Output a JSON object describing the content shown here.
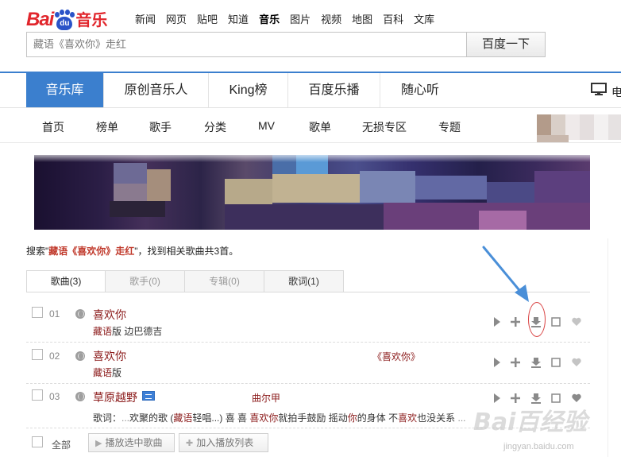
{
  "logo": {
    "bai": "Bai",
    "du": "du",
    "yinle": "音乐"
  },
  "top_nav": [
    {
      "label": "新闻",
      "active": false
    },
    {
      "label": "网页",
      "active": false
    },
    {
      "label": "贴吧",
      "active": false
    },
    {
      "label": "知道",
      "active": false
    },
    {
      "label": "音乐",
      "active": true
    },
    {
      "label": "图片",
      "active": false
    },
    {
      "label": "视频",
      "active": false
    },
    {
      "label": "地图",
      "active": false
    },
    {
      "label": "百科",
      "active": false
    },
    {
      "label": "文库",
      "active": false
    }
  ],
  "search": {
    "value": "藏语《喜欢你》走红",
    "button_label": "百度一下"
  },
  "main_nav": {
    "items": [
      {
        "label": "音乐库",
        "active": true
      },
      {
        "label": "原创音乐人",
        "active": false
      },
      {
        "label": "King榜",
        "active": false
      },
      {
        "label": "百度乐播",
        "active": false
      },
      {
        "label": "随心听",
        "active": false
      }
    ],
    "pc_label": "电"
  },
  "sub_nav": [
    "首页",
    "榜单",
    "歌手",
    "分类",
    "MV",
    "歌单",
    "无损专区",
    "专题"
  ],
  "result_summary": {
    "prefix": "搜索\"",
    "keyword": "藏语《喜欢你》走红",
    "suffix": "\"，找到相关歌曲共3首。"
  },
  "tabs": [
    {
      "label": "歌曲(3)",
      "active": true
    },
    {
      "label": "歌手(0)",
      "active": false
    },
    {
      "label": "专辑(0)",
      "active": false
    },
    {
      "label": "歌词(1)",
      "active": false
    }
  ],
  "songs": [
    {
      "num": "01",
      "title": "喜欢你",
      "sub_hl": "藏语",
      "sub_rest": "版 边巴德吉",
      "album": "",
      "singer": ""
    },
    {
      "num": "02",
      "title": "喜欢你",
      "sub_hl": "藏语",
      "sub_rest": "版",
      "album": "《喜欢你》",
      "singer": ""
    },
    {
      "num": "03",
      "title": "草原越野",
      "sub_hl": "",
      "sub_rest": "",
      "album": "",
      "singer": "曲尔甲"
    }
  ],
  "lyric_row": {
    "label": "歌词：",
    "parts": [
      {
        "text": "...",
        "hl": false,
        "dim": true
      },
      {
        "text": "欢聚的歌 (",
        "hl": false,
        "dim": false
      },
      {
        "text": "藏语",
        "hl": true,
        "dim": false
      },
      {
        "text": "轻唱...) 喜 喜 ",
        "hl": false,
        "dim": false
      },
      {
        "text": "喜欢你",
        "hl": true,
        "dim": false
      },
      {
        "text": "就拍手鼓励 摇动",
        "hl": false,
        "dim": false
      },
      {
        "text": "你",
        "hl": true,
        "dim": false
      },
      {
        "text": "的身体 不",
        "hl": false,
        "dim": false
      },
      {
        "text": "喜欢",
        "hl": true,
        "dim": false
      },
      {
        "text": "也没关系",
        "hl": false,
        "dim": false
      },
      {
        "text": " ...",
        "hl": false,
        "dim": true
      }
    ]
  },
  "bottom_bar": {
    "select_all": "全部",
    "play_selected": "播放选中歌曲",
    "add_to_list": "加入播放列表"
  },
  "watermark": {
    "logo": "Bai百经验",
    "url": "jingyan.baidu.com"
  },
  "colors": {
    "accent": "#3b7fce",
    "brand_red": "#e1262c",
    "song_title": "#8b1a1a",
    "annotation": "#d94141"
  }
}
